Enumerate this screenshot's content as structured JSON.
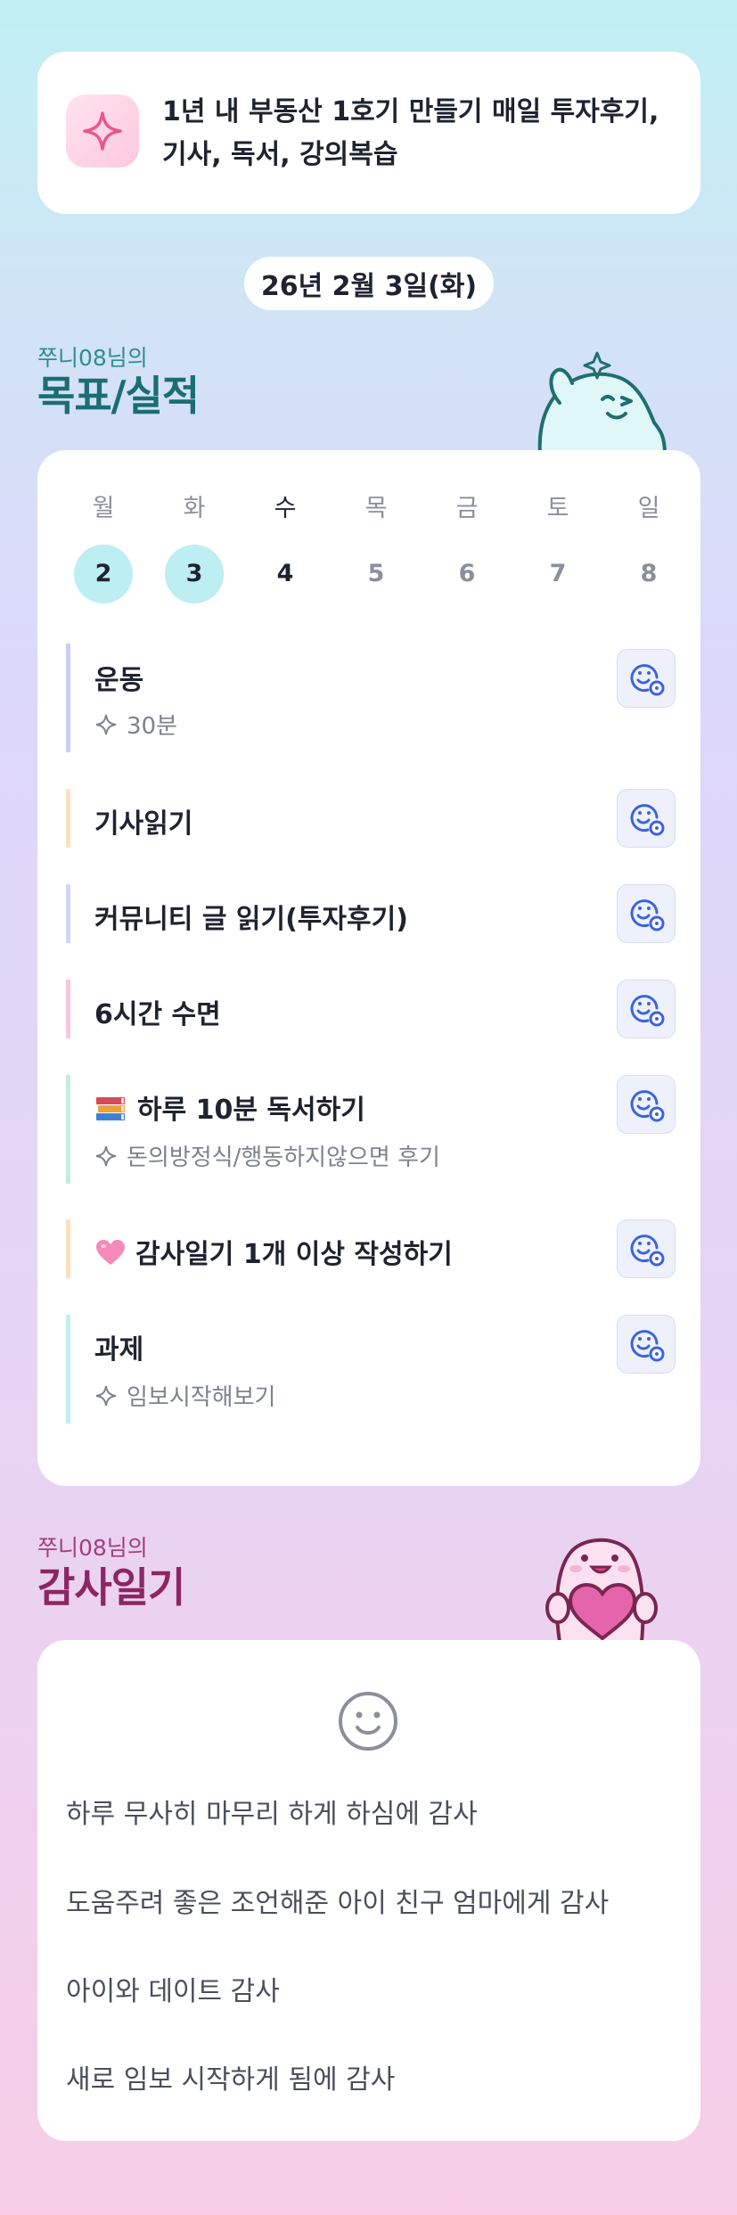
{
  "goal": {
    "icon": "sparkle-icon",
    "text_line1": "1년 내 부동산 1호기 만들기 매일 투자후기,",
    "text_line2": "기사, 독서, 강의복습"
  },
  "date_label": "26년 2월 3일(화)",
  "goals_section": {
    "owner": "쭈니08님의",
    "title": "목표/실적"
  },
  "week": [
    {
      "day": "월",
      "num": "2",
      "state": "past"
    },
    {
      "day": "화",
      "num": "3",
      "state": "past"
    },
    {
      "day": "수",
      "num": "4",
      "state": "today"
    },
    {
      "day": "목",
      "num": "5",
      "state": "future"
    },
    {
      "day": "금",
      "num": "6",
      "state": "future"
    },
    {
      "day": "토",
      "num": "7",
      "state": "future"
    },
    {
      "day": "일",
      "num": "8",
      "state": "future"
    }
  ],
  "tasks": [
    {
      "name": "운동",
      "sub": "30분",
      "bar_color": "#c9cff7"
    },
    {
      "name": "기사읽기",
      "sub": "",
      "bar_color": "#fde1bd"
    },
    {
      "name": "커뮤니티 글 읽기(투자후기)",
      "sub": "",
      "bar_color": "#cfd5f8"
    },
    {
      "name": "6시간 수면",
      "sub": "",
      "bar_color": "#f9c6e1"
    },
    {
      "name": "하루 10분 독서하기",
      "sub": "돈의방정식/행동하지않으면 후기",
      "bar_color": "#c4ecdf",
      "emoji": "books"
    },
    {
      "name": "감사일기 1개 이상 작성하기",
      "sub": "",
      "bar_color": "#fde1bd",
      "emoji": "pink-heart"
    },
    {
      "name": "과제",
      "sub": "임보시작해보기",
      "bar_color": "#bfeef3"
    }
  ],
  "thanks_section": {
    "owner": "쭈니08님의",
    "title": "감사일기",
    "items": [
      "하루 무사히 마무리 하게 하심에 감사",
      "도움주려 좋은 조언해준 아이 친구 엄마에게 감사",
      "아이와 데이트 감사",
      "새로 임보 시작하게 됨에 감사"
    ]
  },
  "colors": {
    "teal_title": "#1a6e72",
    "plum_title": "#8c2663",
    "accent_blue": "#3b63e0",
    "past_day_bg": "#bdeef1"
  }
}
